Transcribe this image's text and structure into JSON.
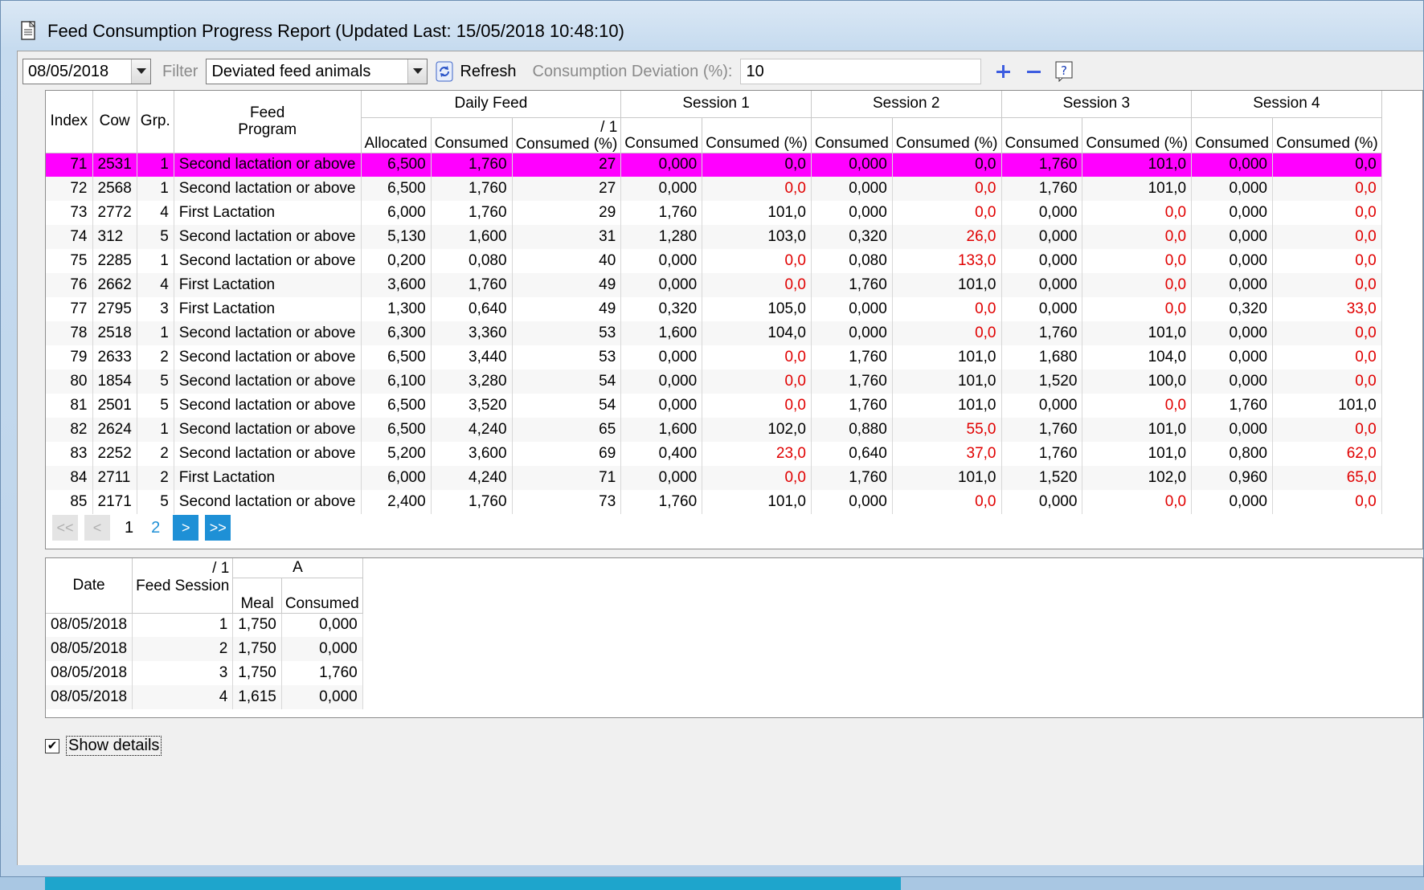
{
  "window": {
    "title": "Feed Consumption Progress Report (Updated Last: 15/05/2018 10:48:10)"
  },
  "toolbar": {
    "date_value": "08/05/2018",
    "filter_label": "Filter",
    "filter_value": "Deviated feed animals",
    "refresh_label": "Refresh",
    "deviation_label": "Consumption Deviation (%):",
    "deviation_value": "10",
    "add_icon": "plus-icon",
    "remove_icon": "minus-icon",
    "help_icon": "help-icon"
  },
  "grid": {
    "headers": {
      "index": "Index",
      "cow": "Cow",
      "group": "Grp.",
      "feed_program_1": "Feed",
      "feed_program_2": "Program",
      "daily_feed": "Daily Feed",
      "session1": "Session 1",
      "session2": "Session 2",
      "session3": "Session 3",
      "session4": "Session 4",
      "allocated": "Allocated",
      "consumed": "Consumed",
      "consumed_pct": "Consumed (%)",
      "sort_marker": "/ 1"
    },
    "rows": [
      {
        "index": "71",
        "cow": "2531",
        "grp": "1",
        "program": "Second lactation or above",
        "alloc": "6,500",
        "cons": "1,760",
        "pct": "27",
        "s1c": "0,000",
        "s1p": "0,0",
        "s2c": "0,000",
        "s2p": "0,0",
        "s3c": "1,760",
        "s3p": "101,0",
        "s4c": "0,000",
        "s4p": "0,0"
      },
      {
        "index": "72",
        "cow": "2568",
        "grp": "1",
        "program": "Second lactation or above",
        "alloc": "6,500",
        "cons": "1,760",
        "pct": "27",
        "s1c": "0,000",
        "s1p": "0,0",
        "s2c": "0,000",
        "s2p": "0,0",
        "s3c": "1,760",
        "s3p": "101,0",
        "s4c": "0,000",
        "s4p": "0,0"
      },
      {
        "index": "73",
        "cow": "2772",
        "grp": "4",
        "program": "First Lactation",
        "alloc": "6,000",
        "cons": "1,760",
        "pct": "29",
        "s1c": "1,760",
        "s1p": "101,0",
        "s2c": "0,000",
        "s2p": "0,0",
        "s3c": "0,000",
        "s3p": "0,0",
        "s4c": "0,000",
        "s4p": "0,0"
      },
      {
        "index": "74",
        "cow": "312",
        "grp": "5",
        "program": "Second lactation or above",
        "alloc": "5,130",
        "cons": "1,600",
        "pct": "31",
        "s1c": "1,280",
        "s1p": "103,0",
        "s2c": "0,320",
        "s2p": "26,0",
        "s3c": "0,000",
        "s3p": "0,0",
        "s4c": "0,000",
        "s4p": "0,0"
      },
      {
        "index": "75",
        "cow": "2285",
        "grp": "1",
        "program": "Second lactation or above",
        "alloc": "0,200",
        "cons": "0,080",
        "pct": "40",
        "s1c": "0,000",
        "s1p": "0,0",
        "s2c": "0,080",
        "s2p": "133,0",
        "s3c": "0,000",
        "s3p": "0,0",
        "s4c": "0,000",
        "s4p": "0,0"
      },
      {
        "index": "76",
        "cow": "2662",
        "grp": "4",
        "program": "First Lactation",
        "alloc": "3,600",
        "cons": "1,760",
        "pct": "49",
        "s1c": "0,000",
        "s1p": "0,0",
        "s2c": "1,760",
        "s2p": "101,0",
        "s3c": "0,000",
        "s3p": "0,0",
        "s4c": "0,000",
        "s4p": "0,0"
      },
      {
        "index": "77",
        "cow": "2795",
        "grp": "3",
        "program": "First Lactation",
        "alloc": "1,300",
        "cons": "0,640",
        "pct": "49",
        "s1c": "0,320",
        "s1p": "105,0",
        "s2c": "0,000",
        "s2p": "0,0",
        "s3c": "0,000",
        "s3p": "0,0",
        "s4c": "0,320",
        "s4p": "33,0"
      },
      {
        "index": "78",
        "cow": "2518",
        "grp": "1",
        "program": "Second lactation or above",
        "alloc": "6,300",
        "cons": "3,360",
        "pct": "53",
        "s1c": "1,600",
        "s1p": "104,0",
        "s2c": "0,000",
        "s2p": "0,0",
        "s3c": "1,760",
        "s3p": "101,0",
        "s4c": "0,000",
        "s4p": "0,0"
      },
      {
        "index": "79",
        "cow": "2633",
        "grp": "2",
        "program": "Second lactation or above",
        "alloc": "6,500",
        "cons": "3,440",
        "pct": "53",
        "s1c": "0,000",
        "s1p": "0,0",
        "s2c": "1,760",
        "s2p": "101,0",
        "s3c": "1,680",
        "s3p": "104,0",
        "s4c": "0,000",
        "s4p": "0,0"
      },
      {
        "index": "80",
        "cow": "1854",
        "grp": "5",
        "program": "Second lactation or above",
        "alloc": "6,100",
        "cons": "3,280",
        "pct": "54",
        "s1c": "0,000",
        "s1p": "0,0",
        "s2c": "1,760",
        "s2p": "101,0",
        "s3c": "1,520",
        "s3p": "100,0",
        "s4c": "0,000",
        "s4p": "0,0"
      },
      {
        "index": "81",
        "cow": "2501",
        "grp": "5",
        "program": "Second lactation or above",
        "alloc": "6,500",
        "cons": "3,520",
        "pct": "54",
        "s1c": "0,000",
        "s1p": "0,0",
        "s2c": "1,760",
        "s2p": "101,0",
        "s3c": "0,000",
        "s3p": "0,0",
        "s4c": "1,760",
        "s4p": "101,0"
      },
      {
        "index": "82",
        "cow": "2624",
        "grp": "1",
        "program": "Second lactation or above",
        "alloc": "6,500",
        "cons": "4,240",
        "pct": "65",
        "s1c": "1,600",
        "s1p": "102,0",
        "s2c": "0,880",
        "s2p": "55,0",
        "s3c": "1,760",
        "s3p": "101,0",
        "s4c": "0,000",
        "s4p": "0,0"
      },
      {
        "index": "83",
        "cow": "2252",
        "grp": "2",
        "program": "Second lactation or above",
        "alloc": "5,200",
        "cons": "3,600",
        "pct": "69",
        "s1c": "0,400",
        "s1p": "23,0",
        "s2c": "0,640",
        "s2p": "37,0",
        "s3c": "1,760",
        "s3p": "101,0",
        "s4c": "0,800",
        "s4p": "62,0"
      },
      {
        "index": "84",
        "cow": "2711",
        "grp": "2",
        "program": "First Lactation",
        "alloc": "6,000",
        "cons": "4,240",
        "pct": "71",
        "s1c": "0,000",
        "s1p": "0,0",
        "s2c": "1,760",
        "s2p": "101,0",
        "s3c": "1,520",
        "s3p": "102,0",
        "s4c": "0,960",
        "s4p": "65,0"
      },
      {
        "index": "85",
        "cow": "2171",
        "grp": "5",
        "program": "Second lactation or above",
        "alloc": "2,400",
        "cons": "1,760",
        "pct": "73",
        "s1c": "1,760",
        "s1p": "101,0",
        "s2c": "0,000",
        "s2p": "0,0",
        "s3c": "0,000",
        "s3p": "0,0",
        "s4c": "0,000",
        "s4p": "0,0"
      }
    ],
    "selected_row": "71",
    "deviation_color": "#e00000",
    "selection_color": "#ff00ff"
  },
  "pager": {
    "first": "<<",
    "prev": "<",
    "next": ">",
    "last": ">>",
    "current_page": "1",
    "other_page": "2"
  },
  "detail": {
    "headers": {
      "date": "Date",
      "feed_session": "Feed Session",
      "sort_marker": "/ 1",
      "group_a": "A",
      "meal": "Meal",
      "consumed": "Consumed"
    },
    "rows": [
      {
        "date": "08/05/2018",
        "session": "1",
        "meal": "1,750",
        "consumed": "0,000"
      },
      {
        "date": "08/05/2018",
        "session": "2",
        "meal": "1,750",
        "consumed": "0,000"
      },
      {
        "date": "08/05/2018",
        "session": "3",
        "meal": "1,750",
        "consumed": "1,760"
      },
      {
        "date": "08/05/2018",
        "session": "4",
        "meal": "1,615",
        "consumed": "0,000"
      }
    ]
  },
  "show_details": {
    "label": "Show details",
    "checked": true
  }
}
